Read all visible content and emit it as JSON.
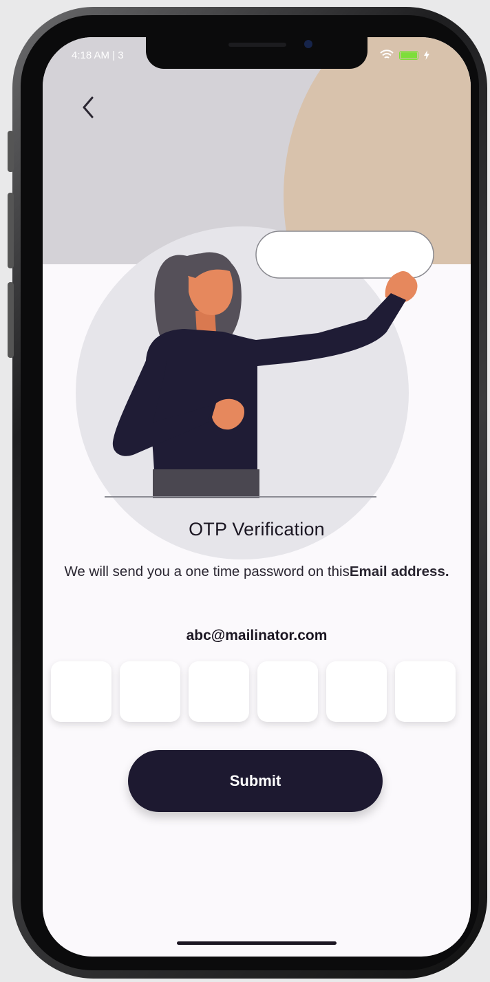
{
  "status_bar": {
    "time": "4:18 AM | 3",
    "battery_color": "#7dde3a"
  },
  "header": {
    "back_icon": "chevron-left-icon"
  },
  "content": {
    "title": "OTP Verification",
    "description_prefix": "We will send you a one time password on this",
    "description_bold": "Email address.",
    "email": "abc@mailinator.com"
  },
  "otp": {
    "length": 6,
    "digits": [
      "",
      "",
      "",
      "",
      "",
      ""
    ]
  },
  "actions": {
    "submit_label": "Submit"
  },
  "colors": {
    "primary": "#1d1930",
    "background": "#fbf9fc",
    "accent_tan": "#d8c2ac",
    "accent_grey": "#d4d2d7"
  }
}
